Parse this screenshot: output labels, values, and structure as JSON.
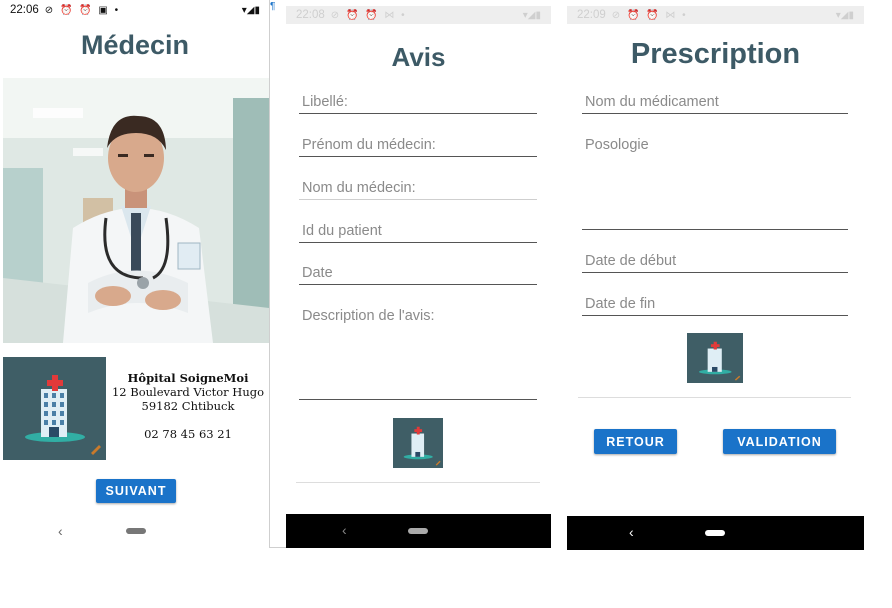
{
  "screens": {
    "medecin": {
      "status_time": "22:06",
      "title": "Médecin",
      "hospital": {
        "name": "Hôpital SoigneMoi",
        "address": "12 Boulevard Victor Hugo",
        "city": "59182 Chtibuck",
        "phone": "02 78 45 63 21"
      },
      "next_button": "SUIVANT"
    },
    "avis": {
      "status_time": "22:08",
      "title": "Avis",
      "fields": {
        "libelle": "Libellé:",
        "prenom": "Prénom du médecin:",
        "nom": "Nom du médecin:",
        "id_patient": "Id du patient",
        "date": "Date",
        "description": "Description de l'avis:"
      }
    },
    "prescription": {
      "status_time": "22:09",
      "title": "Prescription",
      "fields": {
        "medicament": "Nom du médicament",
        "posologie": "Posologie",
        "date_debut": "Date de début",
        "date_fin": "Date de fin"
      },
      "back_button": "RETOUR",
      "validate_button": "VALIDATION"
    }
  },
  "colors": {
    "title": "#3d5a66",
    "button": "#1a73c9",
    "icon_bg": "#3f5e66"
  }
}
